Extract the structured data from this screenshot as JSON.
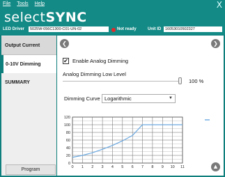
{
  "menu": {
    "file": "File",
    "tools": "Tools",
    "help": "Help"
  },
  "window": {
    "close_glyph": "X"
  },
  "brand": {
    "part1": "select",
    "part2": "SYNC"
  },
  "driver": {
    "label": "LED Driver",
    "value": "5025W-056C1300-C01-UN-02",
    "status": "Not ready",
    "status_color": "#e12a2a"
  },
  "unit": {
    "label": "Unit ID",
    "value": "16053010502327"
  },
  "sidebar": {
    "items": [
      {
        "label": "Output Current"
      },
      {
        "label": "0-10V Dimming"
      },
      {
        "label": "SUMMARY"
      }
    ],
    "program_label": "Program"
  },
  "content": {
    "enable_checked": "✔",
    "enable_label": "Enable Analog Dimming",
    "low_level_label": "Analog Dimming Low Level",
    "low_level_value": "100 %",
    "curve_label": "Dimming Curve",
    "curve_selected": "Logarithmic"
  },
  "icons": {
    "back": "back-arrow-icon",
    "forward": "forward-arrow-icon",
    "home": "home-up-icon"
  },
  "colors": {
    "accent": "#0e7f7c",
    "curve": "#6aa8e0"
  },
  "chart_data": {
    "type": "line",
    "x_ticks": [
      "0",
      "1",
      "2",
      "3",
      "4",
      "5",
      "6",
      "7",
      "8",
      "9",
      "10",
      "11"
    ],
    "y_ticks": [
      "0",
      "20",
      "40",
      "60",
      "80",
      "100",
      "120"
    ],
    "xlim": [
      0,
      11
    ],
    "ylim": [
      0,
      120
    ],
    "grid": true,
    "series": [
      {
        "x": [
          0,
          1,
          2,
          3,
          4,
          5,
          6,
          7,
          8,
          9,
          10,
          11
        ],
        "y": [
          15,
          20,
          27,
          36,
          46,
          58,
          72,
          100,
          100,
          100,
          100,
          100
        ]
      }
    ]
  }
}
